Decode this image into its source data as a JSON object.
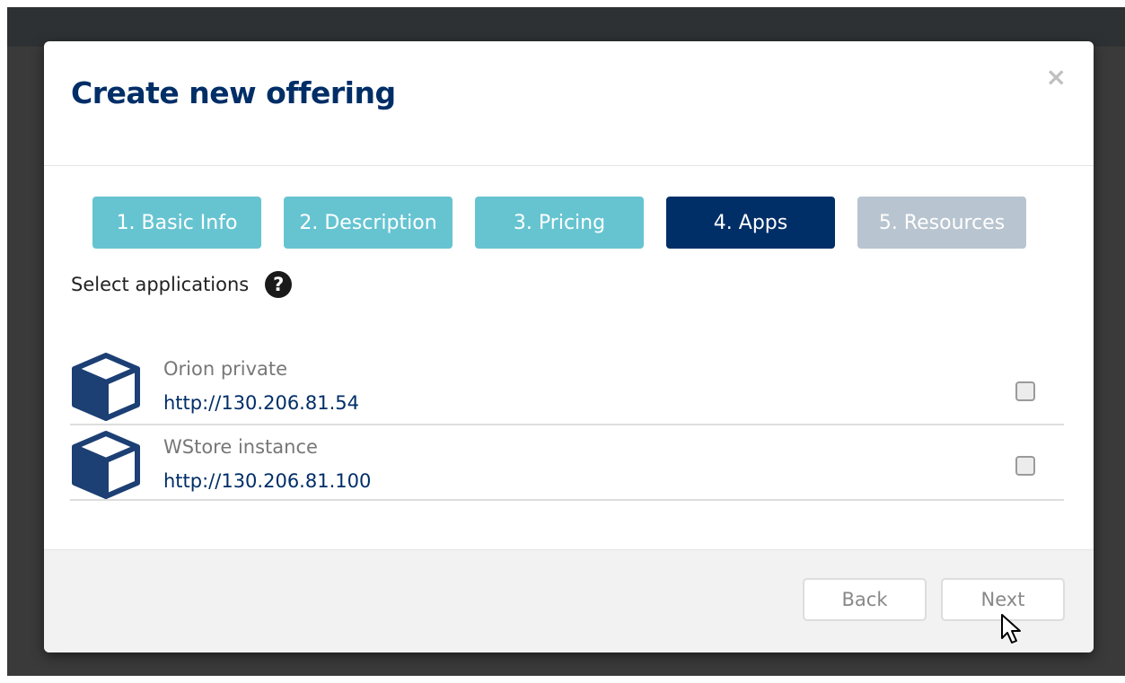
{
  "modal": {
    "title": "Create new offering",
    "close_label": "×"
  },
  "steps": [
    {
      "label": "1. Basic Info",
      "state": "done"
    },
    {
      "label": "2. Description",
      "state": "done"
    },
    {
      "label": "3. Pricing",
      "state": "done"
    },
    {
      "label": "4. Apps",
      "state": "active"
    },
    {
      "label": "5. Resources",
      "state": "pending"
    }
  ],
  "applications": {
    "label": "Select applications",
    "help_icon": "?",
    "items": [
      {
        "name": "Orion private",
        "url": "http://130.206.81.54",
        "checked": false,
        "icon": "cube-icon"
      },
      {
        "name": "WStore instance",
        "url": "http://130.206.81.100",
        "checked": false,
        "icon": "cube-icon"
      }
    ]
  },
  "footer": {
    "back_label": "Back",
    "next_label": "Next"
  },
  "colors": {
    "step_done": "#66c4d1",
    "step_active": "#002e67",
    "step_pending": "#b8c4cf",
    "title": "#002e67"
  }
}
